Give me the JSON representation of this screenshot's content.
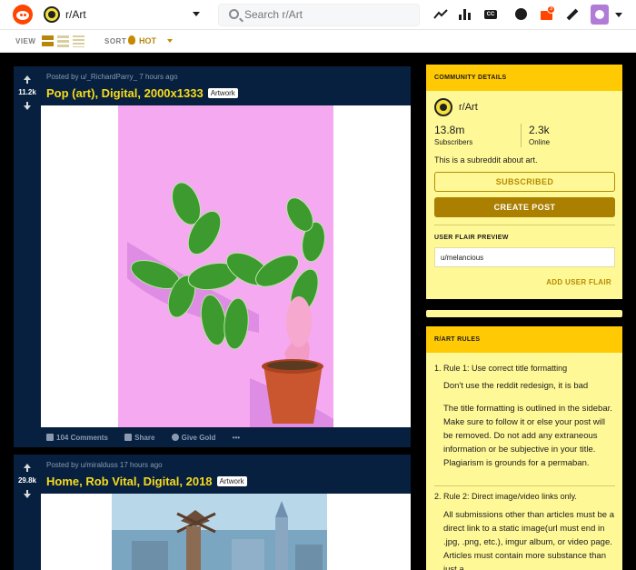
{
  "header": {
    "subreddit": "r/Art",
    "search_placeholder": "Search r/Art",
    "mail_badge": "3",
    "cc_icon_text": "CC"
  },
  "sortbar": {
    "view_label": "VIEW",
    "sort_label": "SORT",
    "sort_value": "HOT"
  },
  "posts": [
    {
      "votes": "11.2k",
      "meta": "Posted by u/_RichardParry_ 7 hours ago",
      "title": "Pop (art), Digital, 2000x1333",
      "flair": "Artwork",
      "comments": "104 Comments",
      "share": "Share",
      "give_gold": "Give Gold",
      "more": "•••"
    },
    {
      "votes": "29.8k",
      "meta": "Posted by u/miralduss 17 hours ago",
      "title": "Home, Rob Vital, Digital, 2018",
      "flair": "Artwork"
    }
  ],
  "community": {
    "header": "COMMUNITY DETAILS",
    "name": "r/Art",
    "subscribers": "13.8m",
    "subscribers_label": "Subscribers",
    "online": "2.3k",
    "online_label": "Online",
    "description": "This is a subreddit about art.",
    "subscribed_btn": "SUBSCRIBED",
    "create_post_btn": "CREATE POST",
    "flair_preview_label": "USER FLAIR PREVIEW",
    "flair_username": "u/melancious",
    "add_flair": "ADD USER FLAIR"
  },
  "rules": {
    "header": "R/ART RULES",
    "items": [
      {
        "num": "1.",
        "title": "Rule 1: Use correct title formatting",
        "body1": "Don't use the reddit redesign, it is bad",
        "body2": "The title formatting is outlined in the sidebar. Make sure to follow it or else your post will be removed. Do not add any extraneous information or be subjective in your title. Plagiarism is grounds for a permaban."
      },
      {
        "num": "2.",
        "title": "Rule 2: Direct image/video links only.",
        "body1": "All submissions other than articles must be a direct link to a static image(url must end in .jpg, .png, etc.), imgur album, or video page. Articles must contain more substance than just a"
      }
    ]
  },
  "colors": {
    "post_bg": "#07203f",
    "title": "#f8dc1c",
    "card_bg": "#fff897",
    "card_header": "#ffc904",
    "accent": "#ab7f00"
  }
}
